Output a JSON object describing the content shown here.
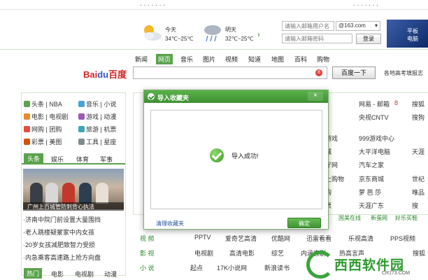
{
  "topbar": {
    "left": "· ·  · · ·  ·  ·",
    "right": "·  ·  ·   ·  · · ·"
  },
  "weather": {
    "today": {
      "label": "今天",
      "temp": "34℃~25℃",
      "icon": "sun-cloud-icon"
    },
    "tomorrow": {
      "label": "明天",
      "temp": "32℃~25℃",
      "icon": "rain-cloud-icon"
    },
    "more": "›"
  },
  "login": {
    "user_placeholder": "请输入邮箱用户名",
    "pass_placeholder": "请输入邮箱密码",
    "domain": "@163.com",
    "button": "登录"
  },
  "ad": {
    "line1": "平板",
    "line2": "电脑"
  },
  "nav": {
    "items": [
      "新闻",
      "网页",
      "音乐",
      "图片",
      "视频",
      "知道",
      "地图",
      "百科",
      "购物"
    ],
    "active_index": 1
  },
  "search": {
    "logo_bai": "Bai",
    "logo_du": "du",
    "logo_cn": "百度",
    "badge": "8",
    "button": "百度一下",
    "hint": "各地高考填报志"
  },
  "left": {
    "categories": [
      [
        "头条",
        "NBA",
        "音乐",
        "小说"
      ],
      [
        "电影",
        "电视剧",
        "游戏",
        "动漫"
      ],
      [
        "网购",
        "团购",
        "旅游",
        "机票"
      ],
      [
        "彩票",
        "美图",
        "工具",
        "星座"
      ]
    ],
    "tabs": [
      "头条",
      "娱乐",
      "体育",
      "军事"
    ],
    "caption": "广州上百城管防刺背心执法",
    "news": [
      "·济南中院门前设置大量围挡",
      "·老人跳楼疑蒙家中内女孩",
      "·20岁女孩减肥致智力受损",
      "·内急乘客高速路上抢方向盘"
    ],
    "tabs2": [
      "热门",
      "电影",
      "电视剧",
      "动漫"
    ]
  },
  "sites": {
    "col1": [
      "网易 - 邮箱",
      "央视CNTV",
      "999游戏中心",
      "大平洋电脑",
      "汽车之家",
      "京东商城",
      "萝 芭 莎",
      "天涯广东"
    ],
    "col1_badges": [
      "8",
      "",
      "",
      "",
      "",
      "",
      "",
      ""
    ],
    "col0": [
      "",
      "",
      "游戏",
      "城",
      "厅网",
      "上购物",
      "购",
      "票"
    ],
    "col2": [
      "搜狐",
      "搜狗",
      "",
      "天涯",
      "",
      "世纪",
      "唯品",
      "搜"
    ]
  },
  "green_bar": [
    "国美在线",
    "新蛋网",
    "好乐买鞋"
  ],
  "cat_lines": [
    {
      "label": "视  频",
      "items": [
        "PPTV",
        "爱奇艺高清",
        "优酷网",
        "迅雷看看",
        "乐视高清",
        "PPS视频"
      ]
    },
    {
      "label": "影  视",
      "items": [
        "电视剧",
        "高清电影",
        "综艺",
        "内涵喜剧",
        "热高言声",
        "搜狐"
      ]
    },
    {
      "label": "小  说",
      "items": [
        "起点",
        "17K小说网",
        "新浪读书",
        "",
        "",
        ""
      ]
    }
  ],
  "dialog": {
    "title": "导入收藏夹",
    "close": "×",
    "message": "导入成功!",
    "link": "清理收藏夹",
    "confirm": "确定"
  },
  "watermark": {
    "text": "西西软件园",
    "url": "CR173.COM"
  }
}
